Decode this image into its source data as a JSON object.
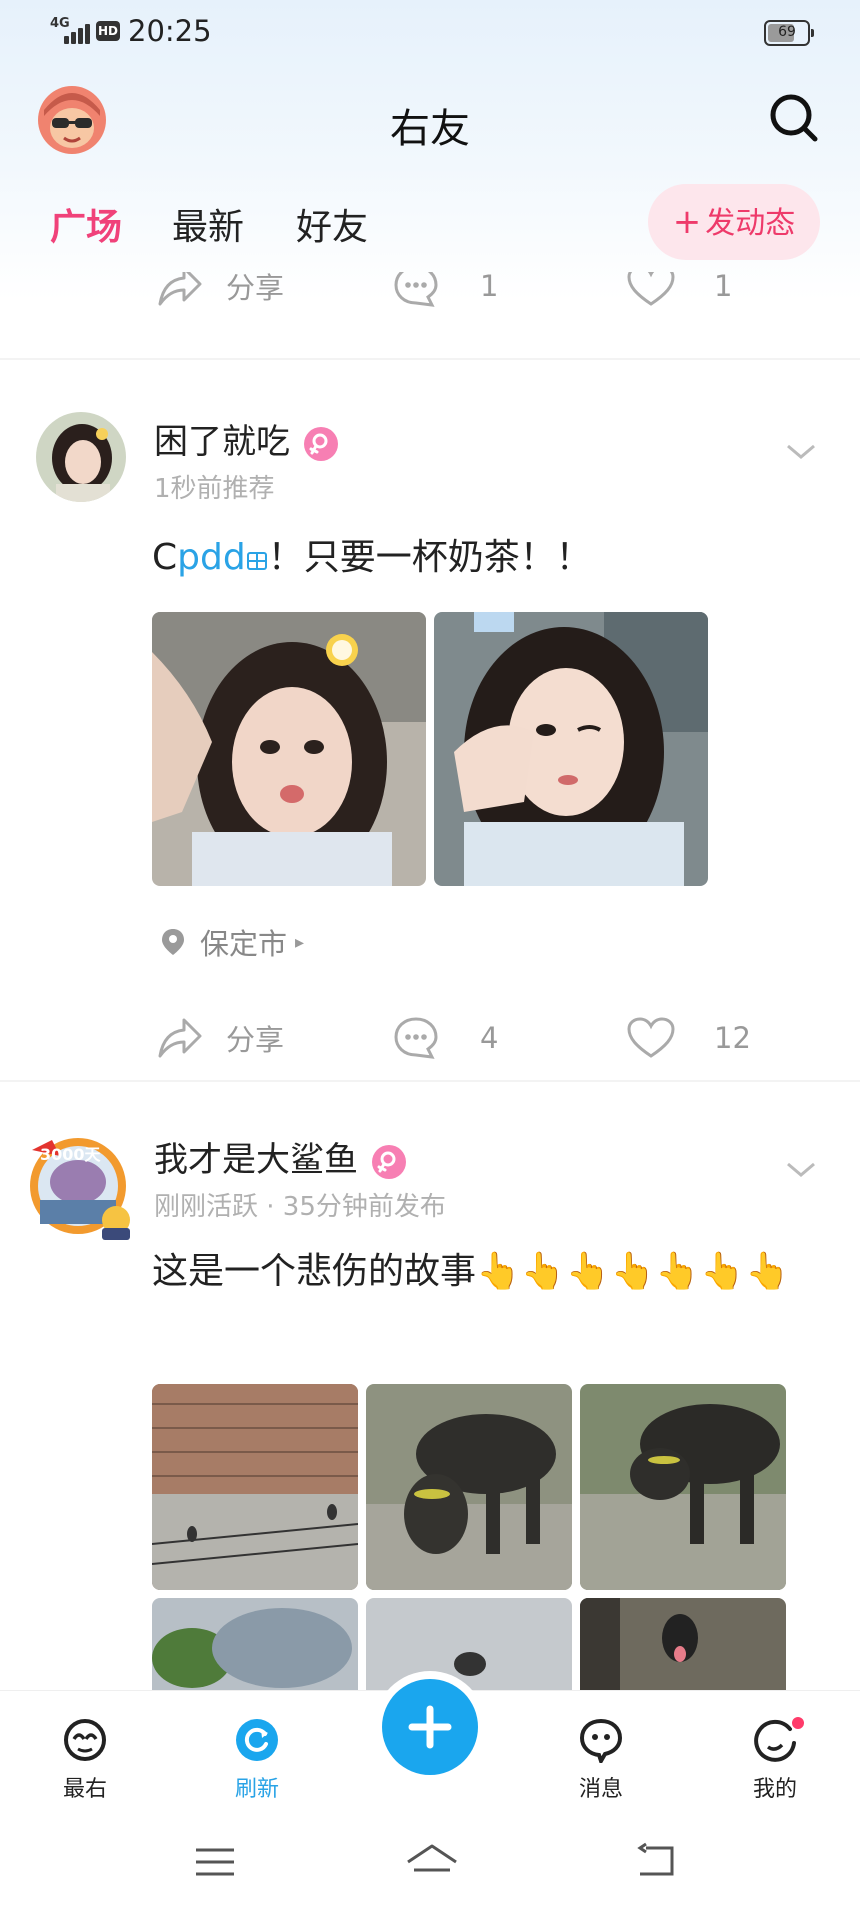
{
  "status_bar": {
    "network": "4G",
    "hd": "HD",
    "time": "20:25",
    "battery": "69"
  },
  "header": {
    "title": "右友",
    "avatar_icon": "user-avatar-cartoon",
    "search_icon": "search-icon"
  },
  "tabs": {
    "items": [
      "广场",
      "最新",
      "好友"
    ],
    "active": 0,
    "post_button": {
      "plus": "+",
      "label": "发动态"
    }
  },
  "colors": {
    "accent_pink": "#f0427a",
    "accent_blue": "#2aa3e6",
    "fab_blue": "#1aa6ee"
  },
  "prev_post_actions": {
    "share": "分享",
    "comments": "1",
    "likes": "1"
  },
  "posts": [
    {
      "name": "困了就吃",
      "meta": "1秒前推荐",
      "text_prefix": "C",
      "text_highlight": "pdd",
      "text_suffix": "！只要一杯奶茶！！",
      "location": "保定市",
      "share": "分享",
      "comments": "4",
      "likes": "12"
    },
    {
      "name": "我才是大鲨鱼",
      "meta": "刚刚活跃 · 35分钟前发布",
      "text": "这是一个悲伤的故事👆👆👆👆👆👆👆",
      "badge": "3000天"
    }
  ],
  "bottom_nav": {
    "items": [
      "最右",
      "刷新",
      "消息",
      "我的"
    ]
  }
}
